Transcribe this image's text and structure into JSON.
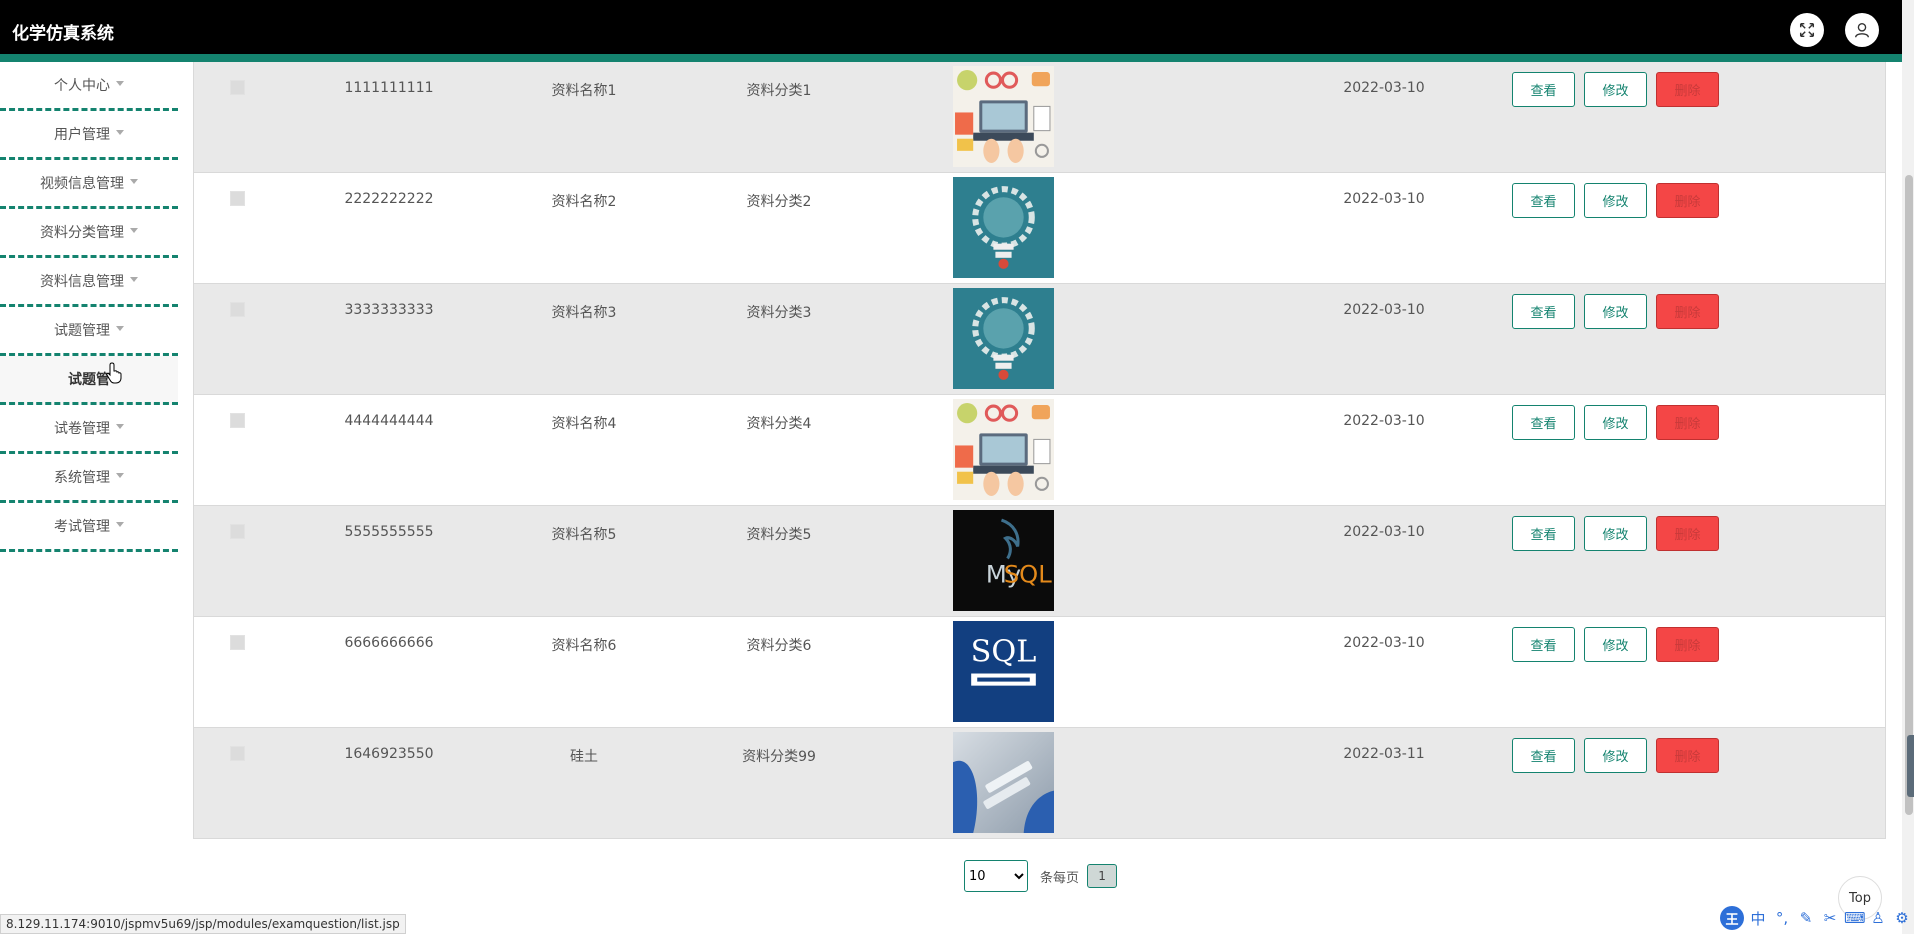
{
  "header": {
    "title": "化学仿真系统",
    "fullscreen_icon": "expand-icon",
    "user_icon": "user-icon"
  },
  "sidebar": {
    "items": [
      {
        "label": "个人中心"
      },
      {
        "label": "用户管理"
      },
      {
        "label": "视频信息管理"
      },
      {
        "label": "资料分类管理"
      },
      {
        "label": "资料信息管理"
      },
      {
        "label": "试题管理"
      }
    ],
    "active_sub": "试题管",
    "items_after": [
      {
        "label": "试卷管理"
      },
      {
        "label": "系统管理"
      },
      {
        "label": "考试管理"
      }
    ]
  },
  "table": {
    "actions": {
      "view": "查看",
      "edit": "修改",
      "delete": "删除"
    },
    "rows": [
      {
        "id": "1111111111",
        "name": "资料名称1",
        "category": "资料分类1",
        "date": "2022-03-10",
        "image": "laptop-desk-illustration"
      },
      {
        "id": "2222222222",
        "name": "资料名称2",
        "category": "资料分类2",
        "date": "2022-03-10",
        "image": "idea-lightbulb-gear"
      },
      {
        "id": "3333333333",
        "name": "资料名称3",
        "category": "资料分类3",
        "date": "2022-03-10",
        "image": "idea-lightbulb-gear"
      },
      {
        "id": "4444444444",
        "name": "资料名称4",
        "category": "资料分类4",
        "date": "2022-03-10",
        "image": "laptop-desk-illustration"
      },
      {
        "id": "5555555555",
        "name": "资料名称5",
        "category": "资料分类5",
        "date": "2022-03-10",
        "image": "mysql-logo"
      },
      {
        "id": "6666666666",
        "name": "资料名称6",
        "category": "资料分类6",
        "date": "2022-03-10",
        "image": "sql-functions-cover"
      },
      {
        "id": "1646923550",
        "name": "硅土",
        "category": "资料分类99",
        "date": "2022-03-11",
        "image": "lab-syringe-photo"
      }
    ]
  },
  "pager": {
    "page_size": "10",
    "per_page_label": "条每页",
    "current_page": "1"
  },
  "scroll_top": "Top",
  "status_url": "8.129.11.174:9010/jspmv5u69/jsp/modules/examquestion/list.jsp",
  "ime": {
    "logo": "王",
    "mode": "中"
  },
  "colors": {
    "accent": "#14836f",
    "header_bg": "#000000",
    "danger": "#f44646",
    "odd_row": "#e9e9e9"
  }
}
